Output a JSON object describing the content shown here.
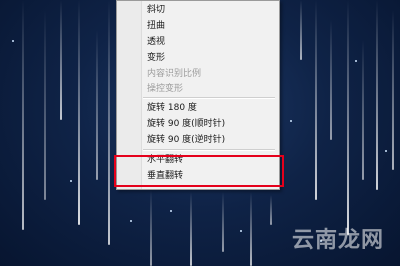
{
  "context_menu": {
    "items": [
      {
        "label": "斜切",
        "disabled": false
      },
      {
        "label": "扭曲",
        "disabled": false
      },
      {
        "label": "透视",
        "disabled": false
      },
      {
        "label": "变形",
        "disabled": false
      },
      {
        "label": "内容识别比例",
        "disabled": true
      },
      {
        "label": "操控变形",
        "disabled": true
      },
      {
        "label": "旋转 180 度",
        "disabled": false
      },
      {
        "label": "旋转 90 度(顺时针)",
        "disabled": false
      },
      {
        "label": "旋转 90 度(逆时针)",
        "disabled": false
      },
      {
        "label": "水平翻转",
        "disabled": false
      },
      {
        "label": "垂直翻转",
        "disabled": false
      }
    ]
  },
  "watermark": "云南龙网",
  "colors": {
    "highlight": "#e5001b",
    "menu_bg": "#f1f1f1",
    "background": "#0f2347"
  }
}
